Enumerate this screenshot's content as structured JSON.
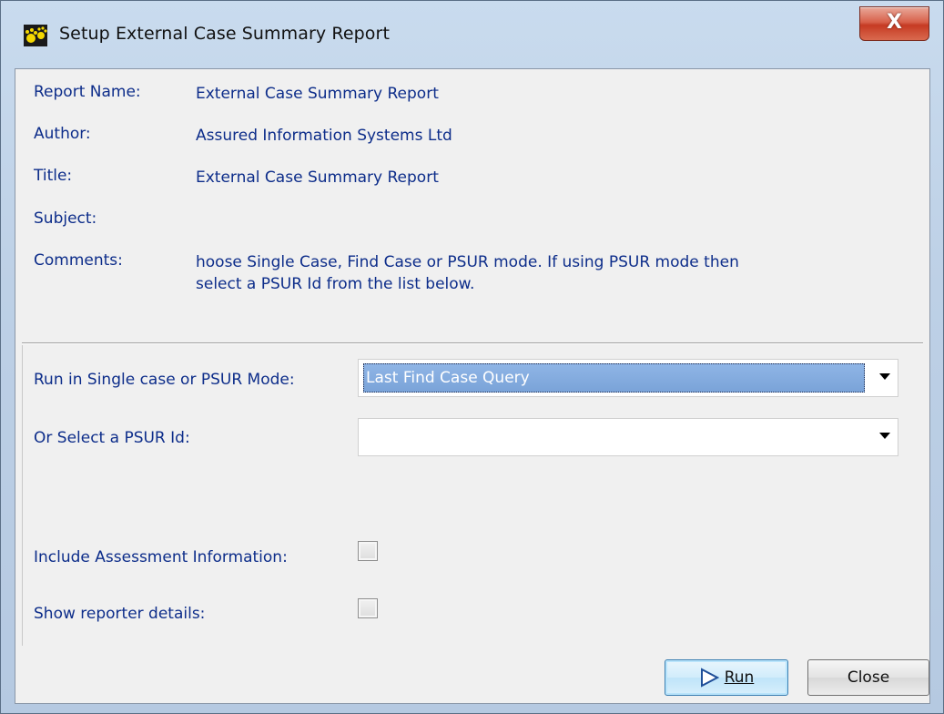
{
  "window": {
    "title": "Setup External Case Summary Report",
    "close_glyph": "X"
  },
  "info": {
    "report_name": {
      "label": "Report Name:",
      "value": "External Case Summary Report"
    },
    "author": {
      "label": "Author:",
      "value": "Assured Information Systems Ltd"
    },
    "title": {
      "label": "Title:",
      "value": "External Case Summary Report"
    },
    "subject": {
      "label": "Subject:",
      "value": ""
    },
    "comments": {
      "label": "Comments:",
      "value_line1": "hoose Single Case, Find Case or PSUR mode. If using PSUR mode then",
      "value_line2": "select a PSUR Id from the list below."
    }
  },
  "options": {
    "mode": {
      "label": "Run in Single case or PSUR Mode:",
      "selected": "Last Find Case Query"
    },
    "psur": {
      "label": "Or Select a PSUR Id:",
      "selected": ""
    },
    "include_assessment": {
      "label": "Include Assessment Information:",
      "checked": false
    },
    "show_reporter": {
      "label": "Show reporter details:",
      "checked": false
    }
  },
  "buttons": {
    "run": "Run",
    "close": "Close"
  },
  "icons": {
    "app": "paw-prints-icon",
    "run": "play-triangle-icon",
    "dropdown": "chevron-down-icon"
  }
}
